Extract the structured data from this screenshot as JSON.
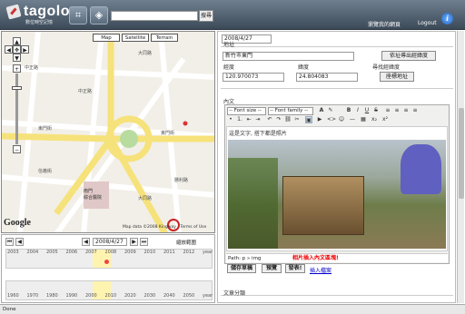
{
  "app": {
    "title": "tagolo",
    "subtitle": "數位時空記憶"
  },
  "header": {
    "search_placeholder": "",
    "search_button": "搜尋",
    "link_album": "瀏覽我的網頁",
    "link_logout": "Logout",
    "icons": [
      "crop-icon",
      "tag-icon",
      "info-icon"
    ]
  },
  "map": {
    "types": [
      "Map",
      "Satellite",
      "Terrain"
    ],
    "copyright": "Map data ©2008 Kingway - Terms of Use",
    "google": "Google",
    "streets": [
      "中正路",
      "中正路",
      "東門街",
      "東門街",
      "東門街",
      "大同路",
      "勝利路",
      "中正路",
      "信義街",
      "文化街",
      "林森路",
      "大同路",
      "民權路"
    ],
    "poi": "南門\n綜合醫院"
  },
  "timeline": {
    "date": "2008/4/27",
    "zoom_label": "縮放範圍",
    "top_ticks": [
      "2003",
      "2004",
      "2005",
      "2006",
      "2007",
      "2008",
      "2009",
      "2010",
      "2011",
      "2012",
      "year"
    ],
    "bottom_ticks": [
      "1960",
      "1970",
      "1980",
      "1990",
      "2000",
      "2010",
      "2020",
      "2030",
      "2040",
      "2050",
      "year"
    ]
  },
  "form": {
    "date_value": "2008/4/27",
    "address_label": "地址",
    "address_value": "新竹市東門",
    "address_btn": "依址導出經緯度",
    "lng_label": "經度",
    "lat_label": "緯度",
    "find_label": "尋找經緯度",
    "lng_value": "120.970073",
    "lat_value": "24.804083",
    "find_btn": "座標地址",
    "content_label": "內文",
    "font_size": "-- Font size --",
    "font_family": "-- Font family --",
    "editor_text": "這是文字, 搭下都是照片",
    "path": "Path: p » img",
    "insert_note": "相片插入內文區塊!",
    "save_btn": "儲存草稿",
    "preview_btn": "預覽",
    "publish_btn": "發表!",
    "insert_link": "插入檔案",
    "category_label": "文章分類"
  },
  "status": {
    "text": "Done"
  }
}
